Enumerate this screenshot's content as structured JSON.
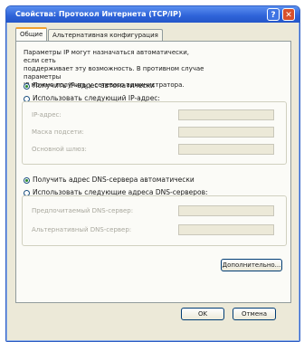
{
  "window": {
    "title": "Свойства: Протокол Интернета (TCP/IP)",
    "help": "?",
    "close": "✕"
  },
  "tabs": [
    {
      "label": "Общие",
      "active": true
    },
    {
      "label": "Альтернативная конфигурация",
      "active": false
    }
  ],
  "intro": "Параметры IP могут назначаться автоматически, если сеть\nподдерживает эту возможность. В противном случае параметры\nIP можно получить у сетевого администратора.",
  "ip": {
    "auto_label": "Получить IP-адрес автоматически",
    "auto_selected": true,
    "manual_label": "Использовать следующий IP-адрес:",
    "fields": [
      {
        "label": "IP-адрес:",
        "value": ""
      },
      {
        "label": "Маска подсети:",
        "value": ""
      },
      {
        "label": "Основной шлюз:",
        "value": ""
      }
    ]
  },
  "dns": {
    "auto_label": "Получить адрес DNS-сервера автоматически",
    "auto_selected": true,
    "manual_label": "Использовать следующие адреса DNS-серверов:",
    "fields": [
      {
        "label": "Предпочитаемый DNS-сервер:",
        "value": ""
      },
      {
        "label": "Альтернативный DNS-сервер:",
        "value": ""
      }
    ]
  },
  "buttons": {
    "advanced": "Дополнительно...",
    "ok": "OK",
    "cancel": "Отмена"
  }
}
